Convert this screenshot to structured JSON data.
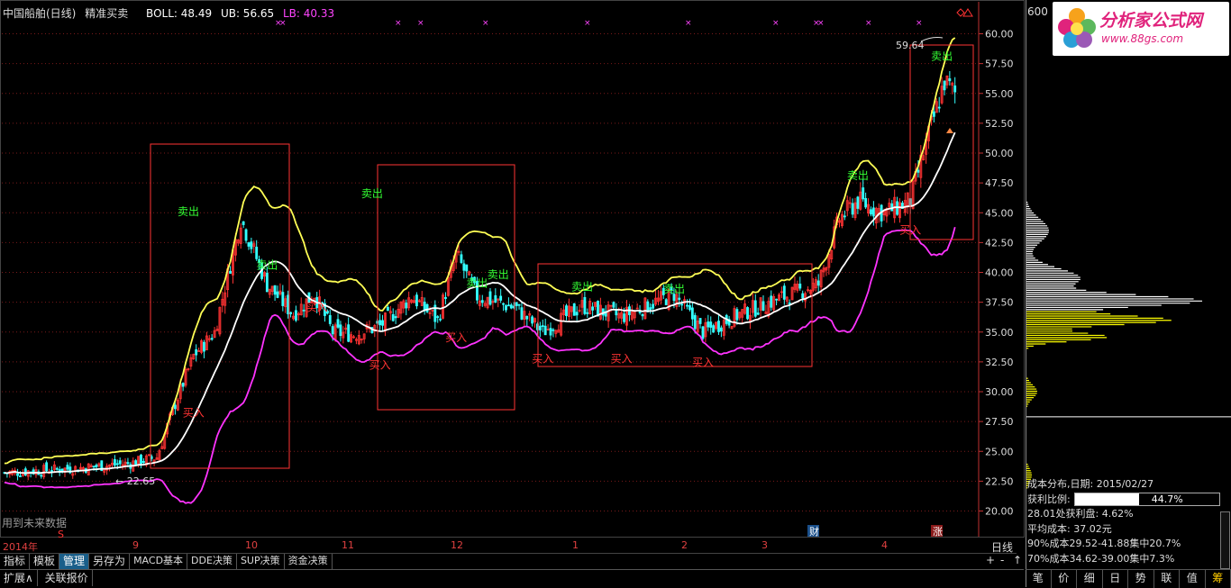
{
  "header": {
    "title": "中国船舶(日线)",
    "indicator": "精准买卖",
    "boll": "BOLL: 48.49",
    "ub": "UB: 56.65",
    "lb": "LB: 40.33"
  },
  "future_note": "用到未来数据",
  "stock_code": "600",
  "logo": {
    "brand": "分析家公式网",
    "url": "www.88gs.com"
  },
  "dates": [
    "2014年",
    "9",
    "10",
    "11",
    "12",
    "1",
    "2",
    "3",
    "4"
  ],
  "dates_day_label": "日线",
  "tabs": [
    "指标",
    "模板",
    "管理",
    "另存为",
    "MACD基本",
    "DDE决策",
    "SUP决策",
    "资金决策"
  ],
  "bottom": [
    "扩展∧",
    "关联报价"
  ],
  "controls": [
    "+",
    "-",
    "↑"
  ],
  "cost_distribution": {
    "title": "成本分布,日期: 2015/02/27",
    "profit_ratio_label": "获利比例:",
    "profit_ratio": "44.7%",
    "profit_ratio_value": 0.447,
    "profit_at": "28.01处获利盘: 4.62%",
    "avg_cost": "平均成本: 37.02元",
    "cost90": "90%成本29.52-41.88集中20.7%",
    "cost70": "70%成本34.62-39.00集中7.3%"
  },
  "right_tabs": [
    "笔",
    "价",
    "细",
    "日",
    "势",
    "联",
    "值",
    "筹"
  ],
  "chart_data": {
    "type": "candlestick",
    "y_axis_ticks": [
      "60.00",
      "57.50",
      "55.00",
      "52.50",
      "50.00",
      "47.50",
      "45.00",
      "42.50",
      "40.00",
      "37.50",
      "35.00",
      "32.50",
      "30.00",
      "27.50",
      "25.00",
      "22.50",
      "20.00"
    ],
    "ylim": [
      18.5,
      61.5
    ],
    "annotations": {
      "high": "59.64",
      "low": "22.65",
      "buy_label": "买入",
      "sell_label": "卖出",
      "cai_label": "财",
      "zhang_label": "涨",
      "s_label": "S"
    },
    "sell_points": [
      [
        70,
        44.5
      ],
      [
        100,
        40
      ],
      [
        140,
        46
      ],
      [
        180,
        38.5
      ],
      [
        188,
        39.2
      ],
      [
        220,
        38.2
      ],
      [
        255,
        38.0
      ],
      [
        325,
        47.5
      ],
      [
        357,
        57.5
      ]
    ],
    "buy_points": [
      [
        72,
        29
      ],
      [
        119,
        37.8
      ],
      [
        143,
        33
      ],
      [
        172,
        35.3
      ],
      [
        205,
        33.5
      ],
      [
        235,
        33.5
      ],
      [
        266,
        33.2
      ],
      [
        345,
        44.3
      ]
    ]
  },
  "colors": {
    "ub": "#ffff55",
    "mid": "#ffffff",
    "lb": "#ff33ff",
    "up": "#ff3333",
    "down": "#33ffff",
    "sell": "#33ff33",
    "buy": "#ff3333"
  }
}
